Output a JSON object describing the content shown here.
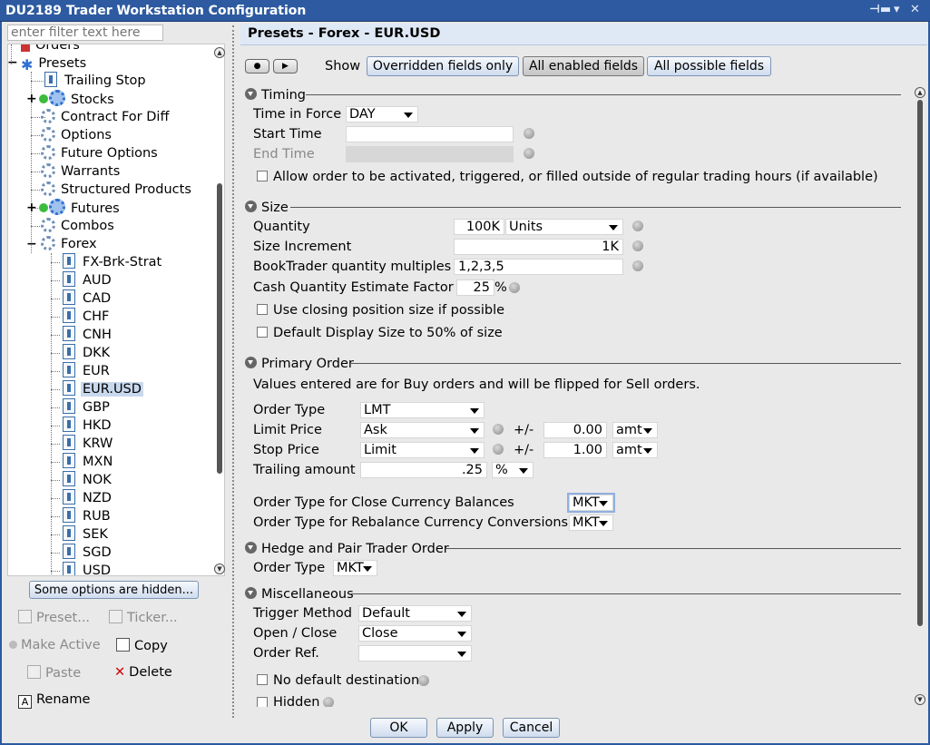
{
  "window": {
    "title": "DU2189 Trader Workstation Configuration",
    "pin_glyph": "⊣▬",
    "menu_glyph": "▾",
    "close_glyph": "✕"
  },
  "left": {
    "filter_placeholder": "enter filter text here",
    "tree": [
      {
        "label": "Orders",
        "icon": "orders-icon",
        "level": 1
      },
      {
        "label": "Presets",
        "icon": "presets-star-icon",
        "level": 1
      },
      {
        "label": "Trailing Stop",
        "icon": "document-icon",
        "level": 2
      },
      {
        "label": "Stocks",
        "icon": "gear-icon",
        "level": 2,
        "active": true,
        "expandable": true
      },
      {
        "label": "Contract For Diff",
        "icon": "gear-icon",
        "level": 2
      },
      {
        "label": "Options",
        "icon": "gear-icon",
        "level": 2
      },
      {
        "label": "Future Options",
        "icon": "gear-icon",
        "level": 2
      },
      {
        "label": "Warrants",
        "icon": "gear-icon",
        "level": 2
      },
      {
        "label": "Structured Products",
        "icon": "gear-icon",
        "level": 2
      },
      {
        "label": "Futures",
        "icon": "gear-icon",
        "level": 2,
        "active": true,
        "expandable": true
      },
      {
        "label": "Combos",
        "icon": "gear-icon",
        "level": 2
      },
      {
        "label": "Forex",
        "icon": "gear-icon",
        "level": 2,
        "expanded": true
      },
      {
        "label": "FX-Brk-Strat",
        "icon": "document-icon",
        "level": 3
      },
      {
        "label": "AUD",
        "icon": "document-icon",
        "level": 3
      },
      {
        "label": "CAD",
        "icon": "document-icon",
        "level": 3
      },
      {
        "label": "CHF",
        "icon": "document-icon",
        "level": 3
      },
      {
        "label": "CNH",
        "icon": "document-icon",
        "level": 3
      },
      {
        "label": "DKK",
        "icon": "document-icon",
        "level": 3
      },
      {
        "label": "EUR",
        "icon": "document-icon",
        "level": 3
      },
      {
        "label": "EUR.USD",
        "icon": "document-icon",
        "level": 3,
        "selected": true
      },
      {
        "label": "GBP",
        "icon": "document-icon",
        "level": 3
      },
      {
        "label": "HKD",
        "icon": "document-icon",
        "level": 3
      },
      {
        "label": "KRW",
        "icon": "document-icon",
        "level": 3
      },
      {
        "label": "MXN",
        "icon": "document-icon",
        "level": 3
      },
      {
        "label": "NOK",
        "icon": "document-icon",
        "level": 3
      },
      {
        "label": "NZD",
        "icon": "document-icon",
        "level": 3
      },
      {
        "label": "RUB",
        "icon": "document-icon",
        "level": 3
      },
      {
        "label": "SEK",
        "icon": "document-icon",
        "level": 3
      },
      {
        "label": "SGD",
        "icon": "document-icon",
        "level": 3
      },
      {
        "label": "USD",
        "icon": "document-icon",
        "level": 3
      }
    ],
    "hidden_options_button": "Some options are hidden...",
    "actions": {
      "preset": "Preset...",
      "ticker": "Ticker...",
      "make_active": "Make Active",
      "copy": "Copy",
      "paste": "Paste",
      "delete": "Delete",
      "rename": "Rename"
    }
  },
  "right": {
    "title": "Presets - Forex - EUR.USD",
    "show_label": "Show",
    "show_buttons": {
      "overridden": "Overridden fields only",
      "enabled": "All enabled fields",
      "possible": "All possible fields"
    },
    "active_show": "enabled",
    "timing": {
      "header": "Timing",
      "tif_label": "Time in Force",
      "tif_value": "DAY",
      "start_label": "Start Time",
      "start_value": "",
      "end_label": "End Time",
      "end_value": "",
      "outside_rth_label": "Allow order to be activated, triggered, or filled outside of regular trading hours (if available)"
    },
    "size": {
      "header": "Size",
      "quantity_label": "Quantity",
      "quantity_value": "100K",
      "quantity_unit": "Units",
      "increment_label": "Size Increment",
      "increment_value": "1K",
      "multiples_label": "BookTrader quantity multiples",
      "multiples_value": "1,2,3,5",
      "cash_label": "Cash Quantity Estimate Factor",
      "cash_value": "25",
      "cash_unit": "%",
      "closing_label": "Use closing position size if possible",
      "display_label": "Default Display Size to 50% of size"
    },
    "primary": {
      "header": "Primary Order",
      "note": "Values entered are for Buy orders and will be flipped for Sell orders.",
      "order_type_label": "Order Type",
      "order_type_value": "LMT",
      "limit_label": "Limit Price",
      "limit_value": "Ask",
      "limit_pm": "+/-",
      "limit_offset": "0.00",
      "limit_unit": "amt",
      "stop_label": "Stop Price",
      "stop_value": "Limit",
      "stop_pm": "+/-",
      "stop_offset": "1.00",
      "stop_unit": "amt",
      "trailing_label": "Trailing amount",
      "trailing_value": ".25",
      "trailing_unit": "%",
      "close_bal_label": "Order Type for Close Currency Balances",
      "close_bal_value": "MKT",
      "rebal_label": "Order Type for Rebalance Currency Conversions",
      "rebal_value": "MKT"
    },
    "hedge": {
      "header": "Hedge and Pair Trader Order",
      "order_type_label": "Order Type",
      "order_type_value": "MKT"
    },
    "misc": {
      "header": "Miscellaneous",
      "trigger_label": "Trigger Method",
      "trigger_value": "Default",
      "openclose_label": "Open / Close",
      "openclose_value": "Close",
      "orderref_label": "Order Ref.",
      "orderref_value": "",
      "no_default_dest_label": "No default destination",
      "hidden_label": "Hidden"
    }
  },
  "footer": {
    "ok": "OK",
    "apply": "Apply",
    "cancel": "Cancel"
  }
}
